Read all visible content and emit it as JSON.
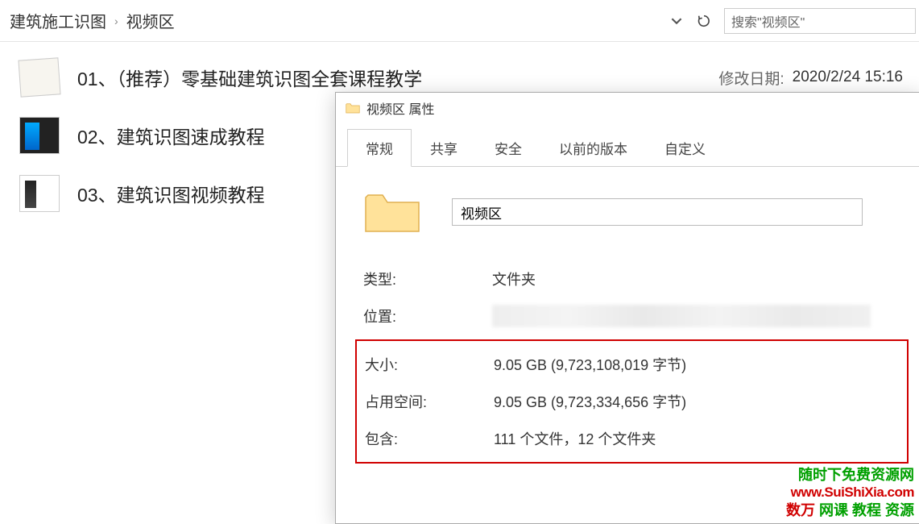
{
  "breadcrumb": {
    "parent": "建筑施工识图",
    "current": "视频区"
  },
  "search": {
    "placeholder": "搜索\"视频区\""
  },
  "files": [
    {
      "name": "01、（推荐）零基础建筑识图全套课程教学",
      "meta_label": "修改日期:",
      "meta_value": "2020/2/24 15:16"
    },
    {
      "name": "02、建筑识图速成教程"
    },
    {
      "name": "03、建筑识图视频教程"
    }
  ],
  "dialog": {
    "title": "视频区 属性",
    "tabs": [
      "常规",
      "共享",
      "安全",
      "以前的版本",
      "自定义"
    ],
    "name_value": "视频区",
    "rows": {
      "type_label": "类型:",
      "type_value": "文件夹",
      "location_label": "位置:",
      "size_label": "大小:",
      "size_value": "9.05 GB (9,723,108,019 字节)",
      "disk_label": "占用空间:",
      "disk_value": "9.05 GB (9,723,334,656 字节)",
      "contains_label": "包含:",
      "contains_value": "111 个文件，12 个文件夹"
    }
  },
  "watermark": {
    "l1": "随时下免费资源网",
    "l2": "www.SuiShiXia.com",
    "l3a": "数万 ",
    "l3b": "网课 教程 资源"
  }
}
